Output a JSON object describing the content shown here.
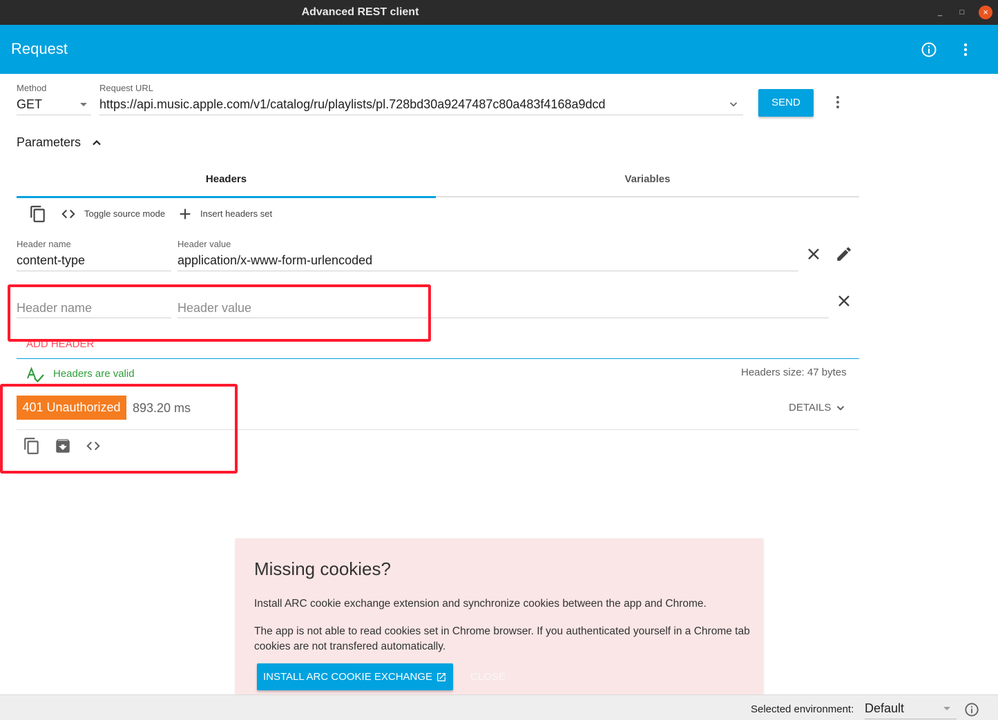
{
  "window": {
    "title": "Advanced REST client",
    "minimize": "_",
    "maximize": "□",
    "close": "×"
  },
  "appbar": {
    "title": "Request"
  },
  "request": {
    "method_label": "Method",
    "method": "GET",
    "url_label": "Request URL",
    "url": "https://api.music.apple.com/v1/catalog/ru/playlists/pl.728bd30a9247487c80a483f4168a9dcd",
    "send": "SEND"
  },
  "parameters": {
    "label": "Parameters"
  },
  "tabs": [
    {
      "label": "Headers",
      "active": true
    },
    {
      "label": "Variables",
      "active": false
    }
  ],
  "toolbar": {
    "toggle_source": "Toggle source mode",
    "insert_set": "Insert headers set"
  },
  "headers": {
    "name_label": "Header name",
    "value_label": "Header value",
    "rows": [
      {
        "name": "content-type",
        "value": "application/x-www-form-urlencoded"
      }
    ],
    "new_name_placeholder": "Header name",
    "new_value_placeholder": "Header value",
    "add": "ADD HEADER",
    "valid_text": "Headers are valid",
    "size_text": "Headers size: 47 bytes"
  },
  "response": {
    "status": "401 Unauthorized",
    "time": "893.20 ms",
    "details": "DETAILS"
  },
  "cookie_card": {
    "title": "Missing cookies?",
    "p1": "Install ARC cookie exchange extension and synchronize cookies between the app and Chrome.",
    "p2": "The app is not able to read cookies set in Chrome browser. If you authenticated yourself in a Chrome tab cookies are not transfered automatically.",
    "install": "INSTALL ARC COOKIE EXCHANGE",
    "close": "CLOSE"
  },
  "statusbar": {
    "env_label": "Selected environment:",
    "env_value": "Default"
  },
  "colors": {
    "accent": "#00a2df",
    "status_orange": "#f57c1f",
    "valid_green": "#2e9d3a",
    "add_red": "#ff4d5b",
    "highlight_red": "#ff1a2e",
    "card_bg": "#fae6e6"
  }
}
